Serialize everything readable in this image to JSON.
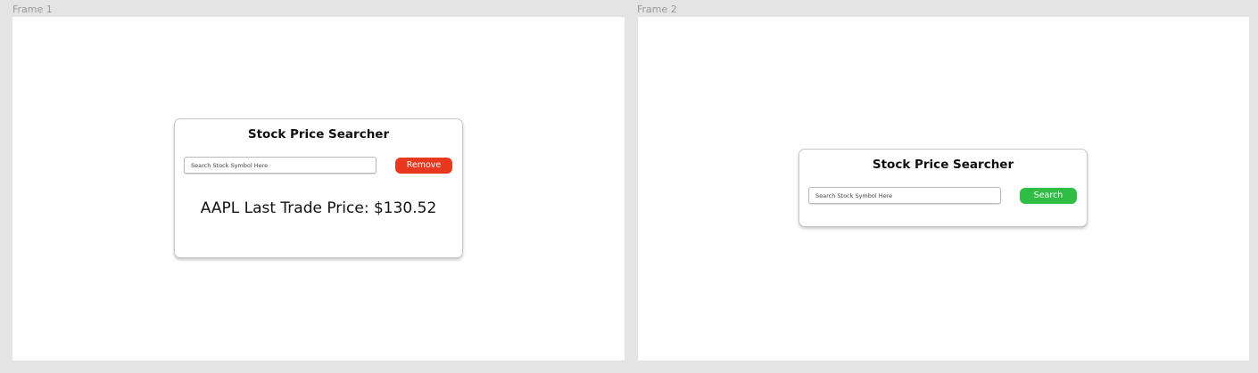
{
  "frames": [
    {
      "label": "Frame 1",
      "card": {
        "title": "Stock Price Searcher",
        "search": {
          "placeholder": "Search Stock Symbol Here",
          "value": ""
        },
        "button": {
          "label": "Remove",
          "color": "#e8391f"
        },
        "result": "AAPL Last Trade Price: $130.52"
      }
    },
    {
      "label": "Frame 2",
      "card": {
        "title": "Stock Price Searcher",
        "search": {
          "placeholder": "Search Stock Symbol Here",
          "value": ""
        },
        "button": {
          "label": "Search",
          "color": "#2fbd45"
        }
      }
    }
  ]
}
